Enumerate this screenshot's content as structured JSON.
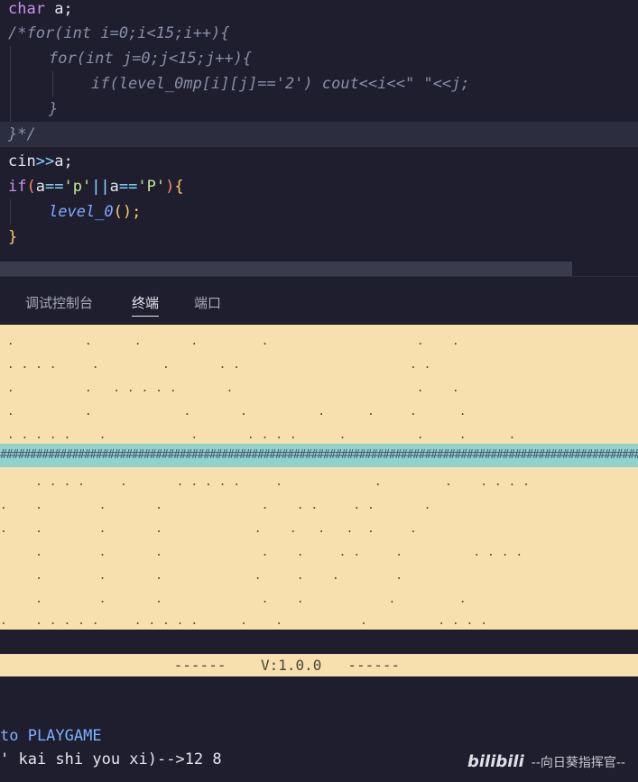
{
  "code": {
    "line1": {
      "kw": "char",
      "rest": " a;"
    },
    "line2": "/*for(int i=0;i<15;i++){",
    "line3": "for(int j=0;j<15;j++){",
    "line4": "if(level_0mp[i][j]=='2') cout<<i<<\" \"<<j;",
    "line5": "}",
    "line6": "}*/",
    "line7": {
      "var": "cin",
      "op": ">>",
      "rest": "a;"
    },
    "line8": {
      "kw": "if",
      "open": "(",
      "a1": "a",
      "eq1": "==",
      "s1": "'p'",
      "or": "||",
      "a2": "a",
      "eq2": "==",
      "s2": "'P'",
      "close": ")",
      "brace": "{"
    },
    "line9": {
      "fn": "level_0",
      "paren": "();"
    },
    "line10": "}"
  },
  "panel_tabs": [
    "调试控制台",
    "终端",
    "端口"
  ],
  "active_tab": "终端",
  "map_rows": [
    " .          .      .       .         .                     .    .",
    " . . . .     .         .       . .                        . .",
    " .          .   . . . . .       .                          .    .",
    " .          .             .       .          .      .     .      .",
    " . . . . .    .            .       . . . .      .          .     .      .",
    "",
    "     . . . .     .       . . . . .     .             .         .    . . . .",
    ".    .        .       .              .    . .     . .       .",
    ".    .        .       .             .    .   .   .  .     .",
    "     .        .       .              .    .     . .     .          . . . .",
    "     .        .       .             .     .    .        .",
    "     .        .       .              .    .            .         .",
    ".    . . . . .     . . . . .      .    .           .          . . . ."
  ],
  "hash_row": "##############################################################################################################",
  "version_line": "                    ------    V:1.0.0   ------",
  "terminal_lines": [
    "to PLAYGAME",
    "' kai shi you xi)-->12 8"
  ],
  "watermark": {
    "logo": "bilibili",
    "text": "--向日葵指挥官--"
  },
  "colors": {
    "map_bg": "#f7dfae",
    "hash_bg": "#8fd3cc",
    "editor_bg": "#1e1e2e",
    "terminal_text": "#7fb0ff"
  }
}
